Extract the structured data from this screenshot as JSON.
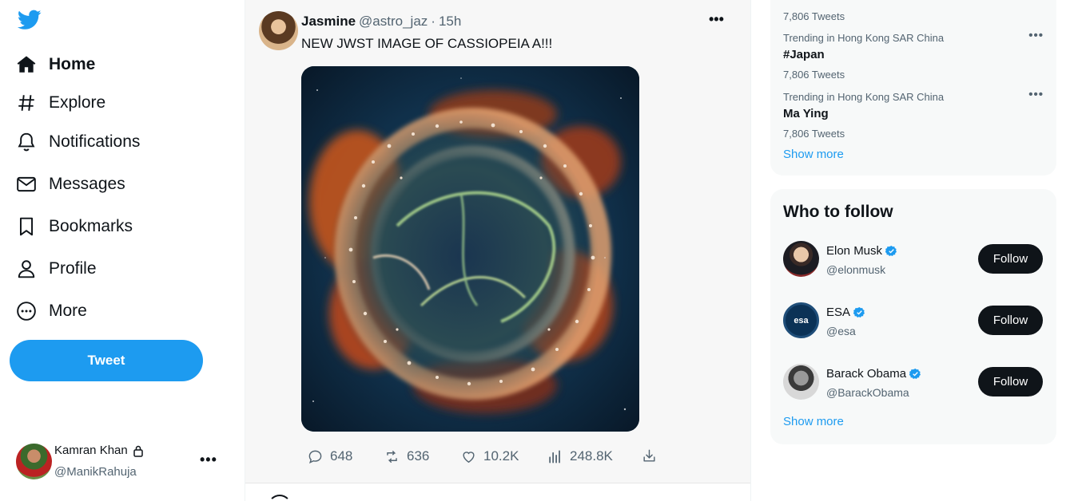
{
  "nav": {
    "items": [
      {
        "label": "Home",
        "icon": "home-icon"
      },
      {
        "label": "Explore",
        "icon": "hash-icon"
      },
      {
        "label": "Notifications",
        "icon": "bell-icon"
      },
      {
        "label": "Messages",
        "icon": "envelope-icon"
      },
      {
        "label": "Bookmarks",
        "icon": "bookmark-icon"
      },
      {
        "label": "Profile",
        "icon": "person-icon"
      },
      {
        "label": "More",
        "icon": "more-circle-icon"
      }
    ],
    "tweet_button": "Tweet"
  },
  "account": {
    "name": "Kamran Khan",
    "handle": "@ManikRahuja",
    "menu": "•••"
  },
  "tweet": {
    "author_name": "Jasmine",
    "author_handle": "@astro_jaz",
    "separator": "·",
    "time": "15h",
    "menu": "•••",
    "text": "NEW JWST IMAGE OF CASSIOPEIA A!!!",
    "stats": {
      "replies": "648",
      "retweets": "636",
      "likes": "10.2K",
      "views": "248.8K"
    }
  },
  "trends": {
    "top_count": "7,806 Tweets",
    "items": [
      {
        "context": "Trending in Hong Kong SAR China",
        "title": "#Japan",
        "count": "7,806 Tweets",
        "menu": "•••"
      },
      {
        "context": "Trending in Hong Kong SAR China",
        "title": "Ma Ying",
        "count": "7,806 Tweets",
        "menu": "•••"
      }
    ],
    "show_more": "Show more"
  },
  "who_to_follow": {
    "title": "Who to follow",
    "people": [
      {
        "name": "Elon Musk",
        "handle": "@elonmusk",
        "button": "Follow"
      },
      {
        "name": "ESA",
        "handle": "@esa",
        "button": "Follow",
        "avatar_text": "esa"
      },
      {
        "name": "Barack Obama",
        "handle": "@BarackObama",
        "button": "Follow"
      }
    ],
    "show_more": "Show more"
  },
  "colors": {
    "accent": "#1d9bf0",
    "text": "#0f1419",
    "muted": "#536471",
    "panel": "#f7f9f9"
  }
}
